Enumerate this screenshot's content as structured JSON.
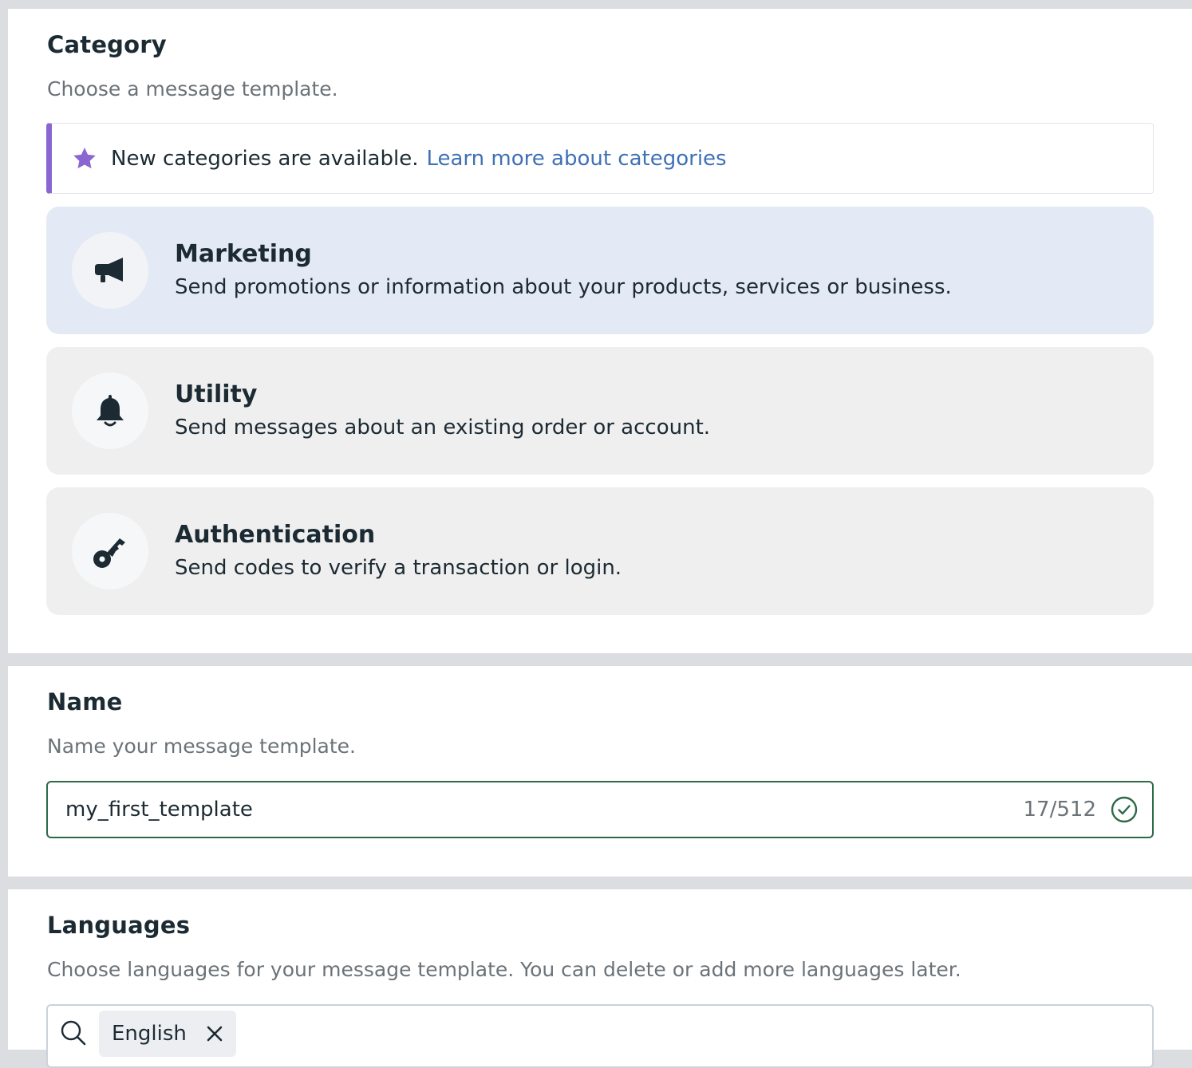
{
  "category": {
    "title": "Category",
    "subtitle": "Choose a message template.",
    "banner": {
      "icon": "star-icon",
      "text": "New categories are available.",
      "link": "Learn more about categories",
      "accent_color": "#8a66d1",
      "link_color": "#3f71b5"
    },
    "options": [
      {
        "title": "Marketing",
        "description": "Send promotions or information about your products, services or business.",
        "icon": "megaphone-icon",
        "selected": true
      },
      {
        "title": "Utility",
        "description": "Send messages about an existing order or account.",
        "icon": "bell-icon",
        "selected": false
      },
      {
        "title": "Authentication",
        "description": "Send codes to verify a transaction or login.",
        "icon": "key-icon",
        "selected": false
      }
    ]
  },
  "name": {
    "title": "Name",
    "subtitle": "Name your message template.",
    "input_value": "my_first_template",
    "char_count": "17/512",
    "valid_icon": "check-circle-icon",
    "valid_color": "#2d6a47"
  },
  "languages": {
    "title": "Languages",
    "subtitle": "Choose languages for your message template. You can delete or add more languages later.",
    "search_icon": "search-icon",
    "selected": [
      {
        "label": "English",
        "remove_icon": "close-icon"
      }
    ]
  }
}
